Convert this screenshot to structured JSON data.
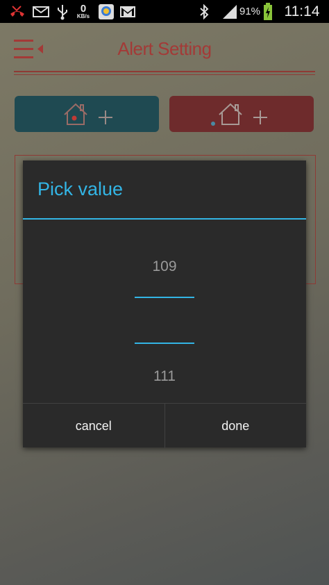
{
  "status_bar": {
    "icons": [
      "missed-call-icon",
      "mail-icon",
      "usb-icon",
      "kb-speed-indicator",
      "app-notification-icon",
      "gmail-icon",
      "bluetooth-icon",
      "signal-icon",
      "battery-charging-icon"
    ],
    "kbs_value": "0",
    "kbs_unit": "KB/s",
    "battery": "91%",
    "time": "11:14"
  },
  "header": {
    "title": "Alert Setting"
  },
  "dialog": {
    "title": "Pick value",
    "previous_value": "109",
    "current_value": "",
    "next_value": "111",
    "cancel_label": "cancel",
    "done_label": "done"
  },
  "colors": {
    "accent": "#33b5e5",
    "app_red": "#a33a37",
    "home_button": "#1f4a52",
    "away_button": "#6e2b2c",
    "dialog_bg": "#2a2a2a"
  }
}
